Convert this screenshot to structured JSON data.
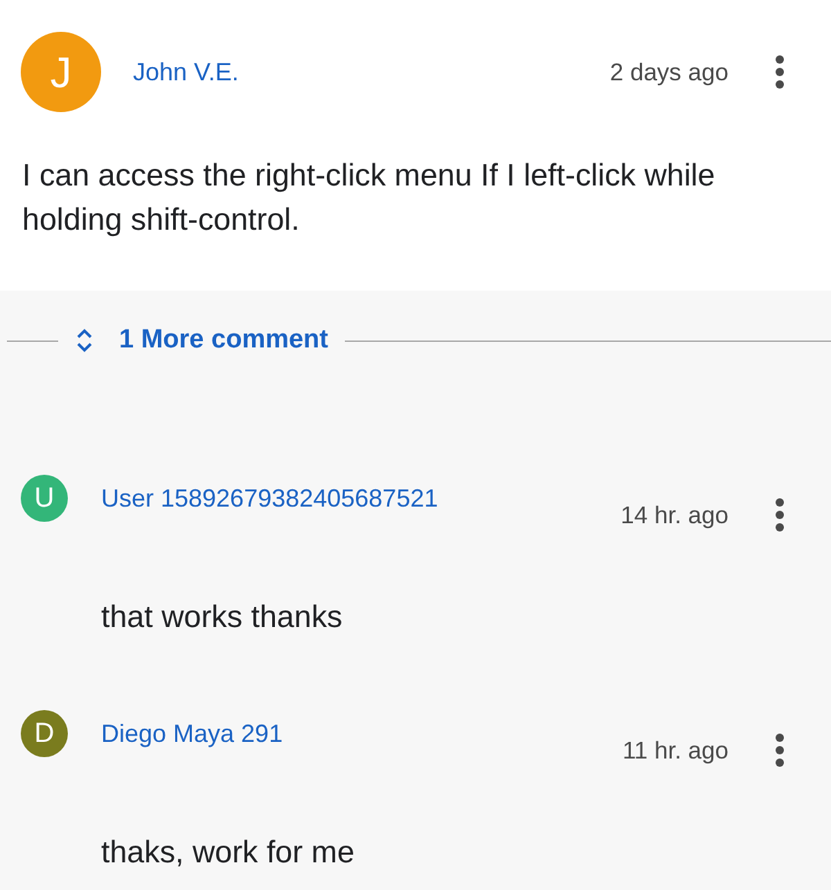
{
  "comment": {
    "author": "John V.E.",
    "initial": "J",
    "color": "#f29a10",
    "time": "2 days ago",
    "text": "I can access the right-click menu If I left-click while holding shift-control."
  },
  "more_comments": {
    "label": "1 More comment"
  },
  "replies": [
    {
      "author": "User 15892679382405687521",
      "initial": "U",
      "color": "#33b679",
      "time": "14 hr. ago",
      "text": "that works thanks"
    },
    {
      "author": "Diego Maya 291",
      "initial": "D",
      "color": "#7a7c1e",
      "time": "11 hr. ago",
      "text": "thaks, work for me"
    }
  ]
}
